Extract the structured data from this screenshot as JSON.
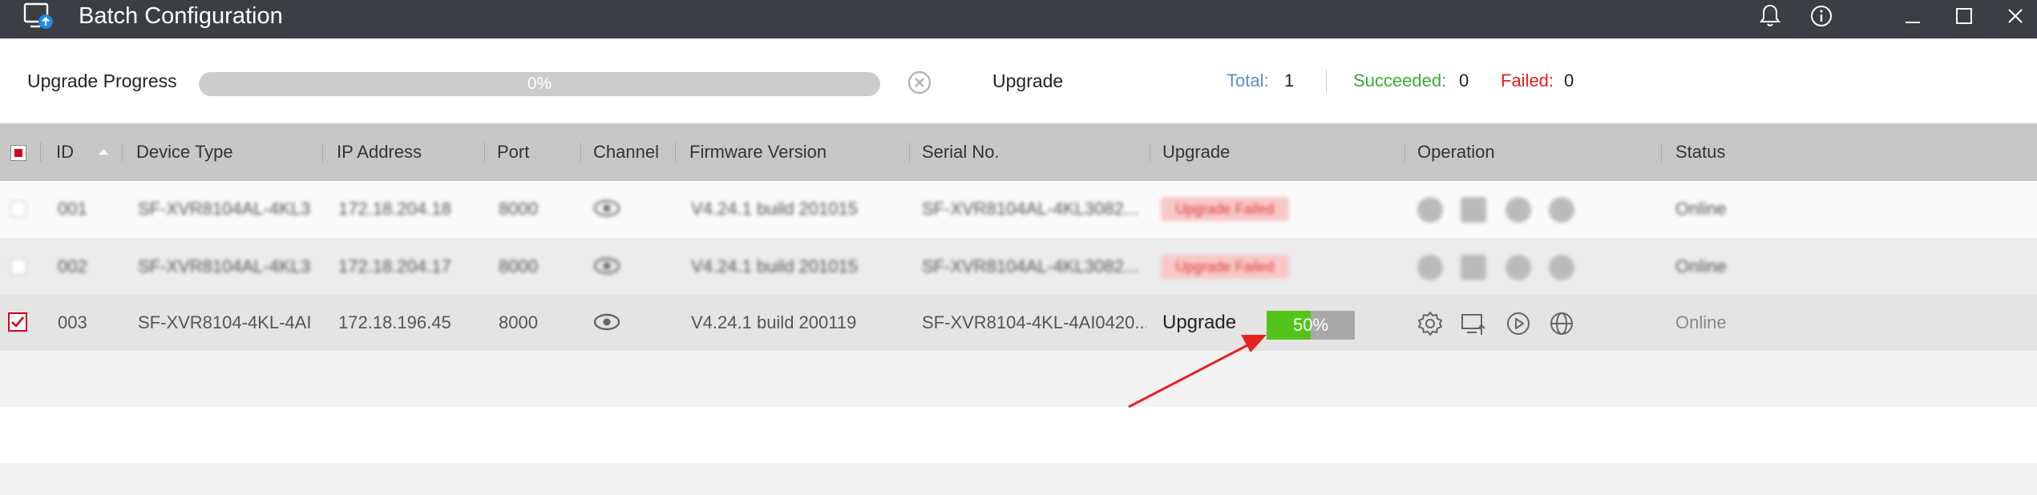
{
  "window": {
    "title": "Batch Configuration"
  },
  "progress": {
    "label": "Upgrade Progress",
    "fraction": 0,
    "text": "0%",
    "upgrade_label": "Upgrade",
    "total_label": "Total:",
    "total_value": "1",
    "succeeded_label": "Succeeded:",
    "succeeded_value": "0",
    "failed_label": "Failed:",
    "failed_value": "0"
  },
  "table": {
    "columns": [
      "ID",
      "Device Type",
      "IP Address",
      "Port",
      "Channel",
      "Firmware Version",
      "Serial No.",
      "Upgrade",
      "Operation",
      "Status"
    ],
    "rows": [
      {
        "id": "001",
        "device_type": "SF-XVR8104AL-4KL3",
        "ip": "172.18.204.18",
        "port": "8000",
        "firmware": "V4.24.1 build 201015",
        "serial": "SF-XVR8104AL-4KL3082...",
        "upgrade": "Upgrade Failed",
        "status": "Online"
      },
      {
        "id": "002",
        "device_type": "SF-XVR8104AL-4KL3",
        "ip": "172.18.204.17",
        "port": "8000",
        "firmware": "V4.24.1 build 201015",
        "serial": "SF-XVR8104AL-4KL3082...",
        "upgrade": "Upgrade Failed",
        "status": "Online"
      },
      {
        "id": "003",
        "device_type": "SF-XVR8104-4KL-4AI",
        "ip": "172.18.196.45",
        "port": "8000",
        "firmware": "V4.24.1 build 200119",
        "serial": "SF-XVR8104-4KL-4AI0420...",
        "upgrade_label": "Upgrade",
        "upgrade_fraction": 0.5,
        "upgrade_text": "50%",
        "status": "Online"
      }
    ]
  },
  "colors": {
    "titlebar": "#3b3e42",
    "total": "#5b8fc9",
    "succeeded": "#3daa36",
    "failed": "#e02020",
    "progress_green": "#52c41a",
    "arrow": "#e8231f"
  }
}
